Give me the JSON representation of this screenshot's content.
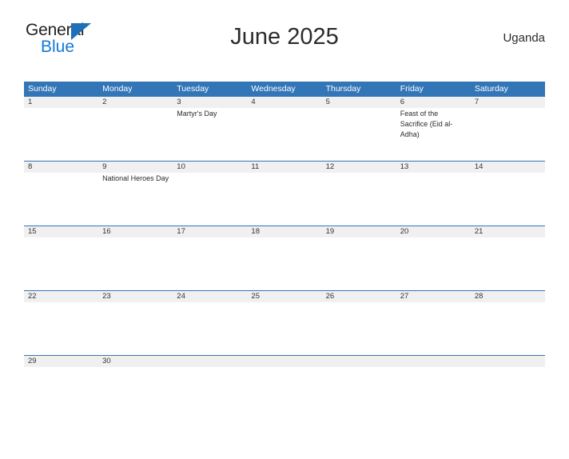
{
  "brand": {
    "name_part1": "General",
    "name_part2": "Blue",
    "triangle_color": "#1d70b8",
    "blue_text_color": "#1279d4"
  },
  "header": {
    "title": "June 2025",
    "country": "Uganda"
  },
  "theme": {
    "header_blue": "#3276b8",
    "row_band_gray": "#f0f0f0",
    "text_dark": "#2b2b2b"
  },
  "calendar": {
    "month": "June",
    "year": "2025",
    "weekdays": [
      "Sunday",
      "Monday",
      "Tuesday",
      "Wednesday",
      "Thursday",
      "Friday",
      "Saturday"
    ],
    "weeks": [
      [
        {
          "day": "1",
          "events": []
        },
        {
          "day": "2",
          "events": []
        },
        {
          "day": "3",
          "events": [
            "Martyr's Day"
          ]
        },
        {
          "day": "4",
          "events": []
        },
        {
          "day": "5",
          "events": []
        },
        {
          "day": "6",
          "events": [
            "Feast of the Sacrifice (Eid al-Adha)"
          ]
        },
        {
          "day": "7",
          "events": []
        }
      ],
      [
        {
          "day": "8",
          "events": []
        },
        {
          "day": "9",
          "events": [
            "National Heroes Day"
          ]
        },
        {
          "day": "10",
          "events": []
        },
        {
          "day": "11",
          "events": []
        },
        {
          "day": "12",
          "events": []
        },
        {
          "day": "13",
          "events": []
        },
        {
          "day": "14",
          "events": []
        }
      ],
      [
        {
          "day": "15",
          "events": []
        },
        {
          "day": "16",
          "events": []
        },
        {
          "day": "17",
          "events": []
        },
        {
          "day": "18",
          "events": []
        },
        {
          "day": "19",
          "events": []
        },
        {
          "day": "20",
          "events": []
        },
        {
          "day": "21",
          "events": []
        }
      ],
      [
        {
          "day": "22",
          "events": []
        },
        {
          "day": "23",
          "events": []
        },
        {
          "day": "24",
          "events": []
        },
        {
          "day": "25",
          "events": []
        },
        {
          "day": "26",
          "events": []
        },
        {
          "day": "27",
          "events": []
        },
        {
          "day": "28",
          "events": []
        }
      ],
      [
        {
          "day": "29",
          "events": []
        },
        {
          "day": "30",
          "events": []
        },
        {
          "day": "",
          "events": []
        },
        {
          "day": "",
          "events": []
        },
        {
          "day": "",
          "events": []
        },
        {
          "day": "",
          "events": []
        },
        {
          "day": "",
          "events": []
        }
      ]
    ]
  }
}
